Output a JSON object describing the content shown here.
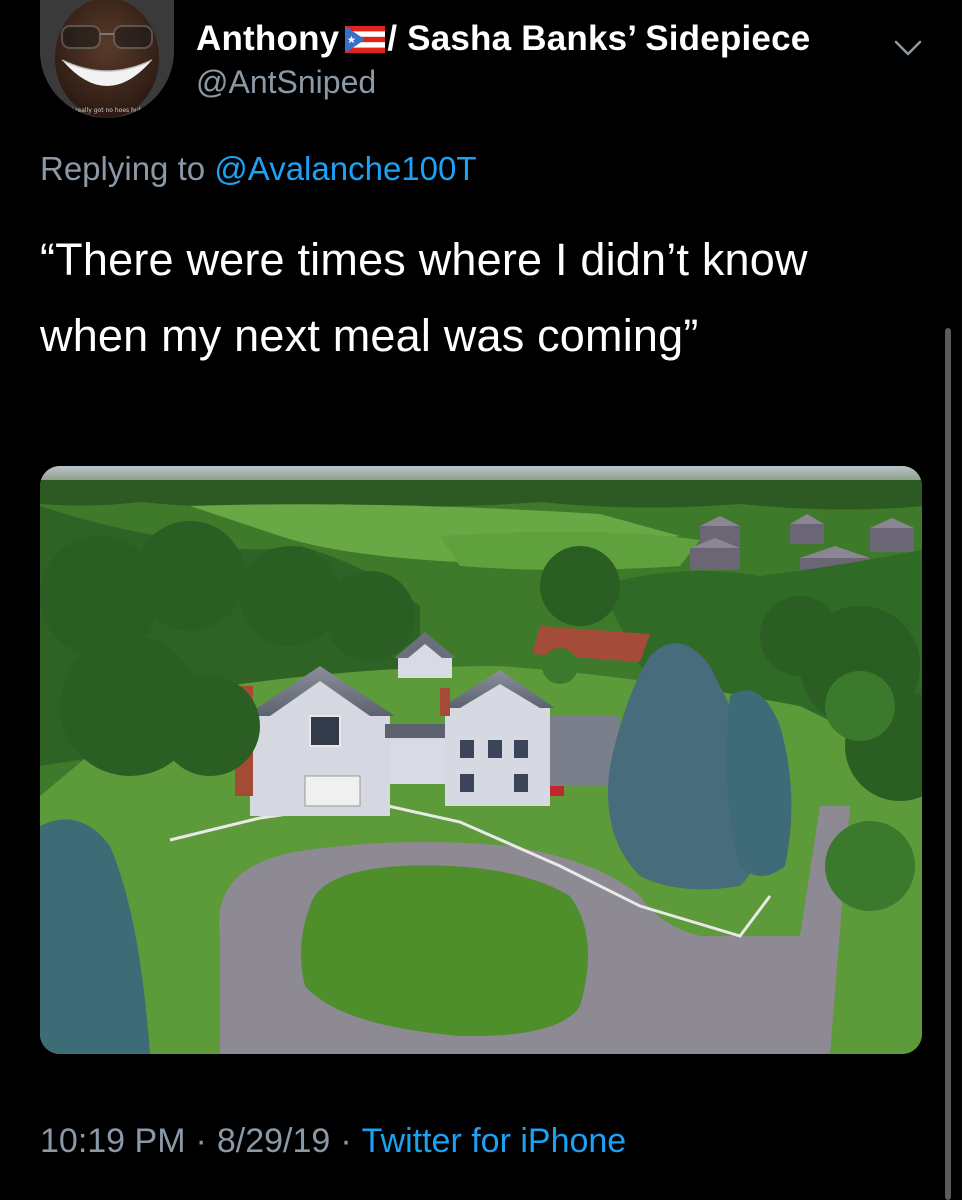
{
  "author": {
    "display_name": "Anthony",
    "display_name_suffix": "/ Sasha Banks’ Sidepiece",
    "handle": "@AntSniped",
    "avatar_caption": "I really got no hoes huh",
    "flag_icon": "puerto-rico-flag-icon"
  },
  "reply": {
    "prefix": "Replying to",
    "mention": "@Avalanche100T"
  },
  "tweet": {
    "text": "“There were times where I didn’t know when my next meal was coming”"
  },
  "media": {
    "type": "photo",
    "icon": "aerial-house-photo"
  },
  "meta": {
    "time": "10:19 PM",
    "date": "8/29/19",
    "separator": "·",
    "source": "Twitter for iPhone"
  },
  "colors": {
    "background": "#000000",
    "secondary_text": "#8b98a5",
    "link": "#1da1f2"
  },
  "caret_icon": "chevron-down-icon"
}
